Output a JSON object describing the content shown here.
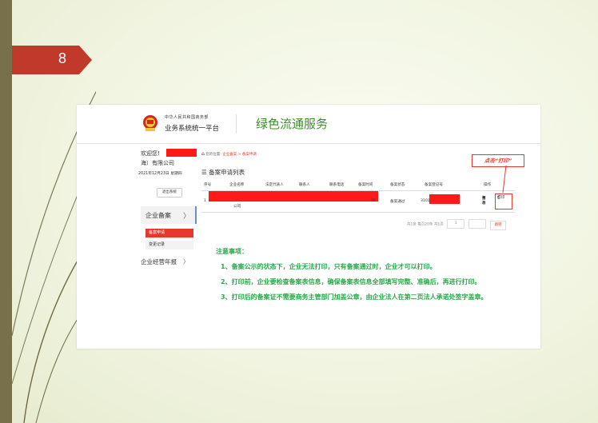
{
  "slide": {
    "number": "8"
  },
  "header": {
    "org": "中华人民共和国商务部",
    "system": "业务系统统一平台",
    "service_title": "绿色流通服务"
  },
  "sidebar": {
    "welcome": "欢迎您!",
    "company": "海）有限公司",
    "date": "2021年12月23日 星期四",
    "logout": "退出系统",
    "menu_filing": "企业备案",
    "menu_filing_arrow": "〉",
    "sub_apply": "备案申请",
    "sub_change": "变更记录",
    "menu_report": "企业经营年报",
    "menu_report_arrow": "〉"
  },
  "main": {
    "location_prefix": "您的位置:",
    "location_path": "企业备案 > 备案申请",
    "list_title": "备案申请列表",
    "columns": [
      "序号",
      "企业名称",
      "法定代表人",
      "联系人",
      "联系电话",
      "备案时间",
      "备案状态",
      "备案登记号",
      "操作"
    ],
    "row": {
      "index": "1",
      "company_tail": "公司",
      "time_tail": "35",
      "status": "备案通过",
      "reg_prefix": "3101",
      "op_view": "查看",
      "op_edit": "修改",
      "op_print": "打印"
    },
    "pager": {
      "summary": "共1条  每页20条  共1页",
      "page": "1",
      "go": "跳转"
    },
    "callout": "点击“打印”"
  },
  "notes": [
    "注意事项：",
    "1、备案公示的状态下，企业无法打印，只有备案通过时，企业才可以打印。",
    "2、打印前，企业要检查备案表信息，确保备案表信息全部填写完整、准确后，再进行打印。",
    "3、打印后的备案证不需要商务主管部门加盖公章，由企业法人在第二页法人承诺处签字盖章。"
  ],
  "colors": {
    "accent_red": "#e8382d",
    "note_green": "#2aa84a",
    "title_green": "#3f8f2a",
    "slide_tab": "#c0392b"
  }
}
